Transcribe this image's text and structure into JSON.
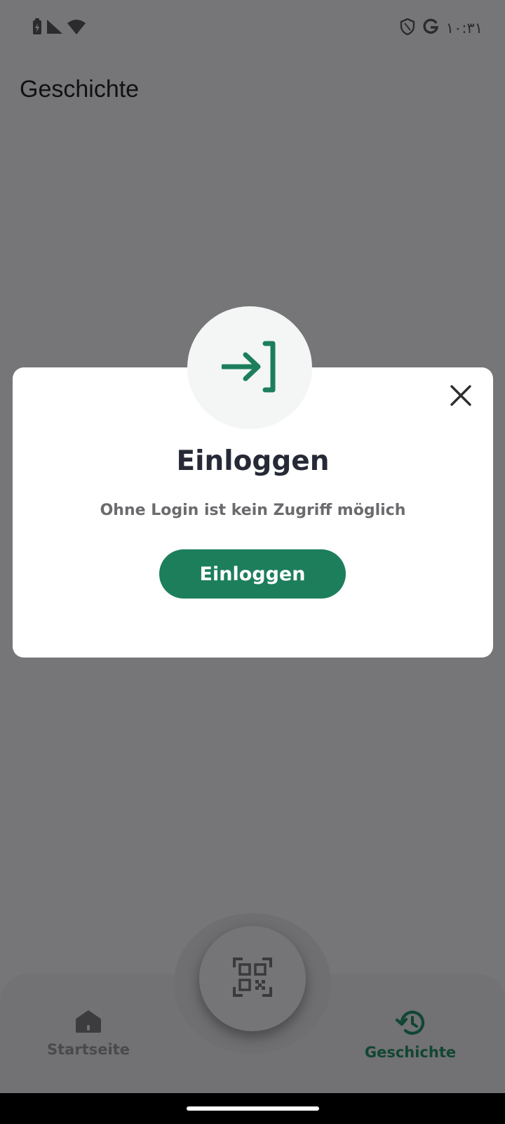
{
  "status_bar": {
    "time": "١٠:٣١",
    "icons": [
      "battery-charging-icon",
      "signal-icon",
      "wifi-icon",
      "shield-icon",
      "google-icon"
    ]
  },
  "page": {
    "title": "Geschichte"
  },
  "dialog": {
    "icon": "login-icon",
    "title": "Einloggen",
    "message": "Ohne Login ist kein Zugriff möglich",
    "button_label": "Einloggen",
    "close_icon": "close-icon"
  },
  "bottom_nav": {
    "items": [
      {
        "label": "Startseite",
        "icon": "home-icon",
        "active": false
      },
      {
        "label": "Geschichte",
        "icon": "history-icon",
        "active": true
      }
    ],
    "fab_icon": "qr-scan-icon"
  },
  "colors": {
    "accent": "#1d7e5c",
    "scrim": "#767578",
    "active_nav": "#114633"
  }
}
